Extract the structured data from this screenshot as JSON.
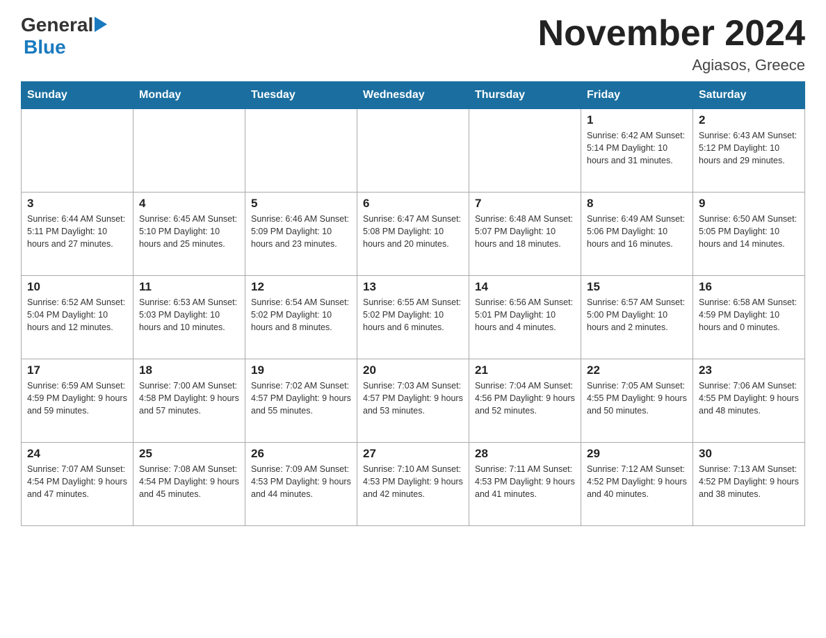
{
  "header": {
    "logo_general": "General",
    "logo_blue": "Blue",
    "month_title": "November 2024",
    "location": "Agiasos, Greece"
  },
  "days_of_week": [
    "Sunday",
    "Monday",
    "Tuesday",
    "Wednesday",
    "Thursday",
    "Friday",
    "Saturday"
  ],
  "weeks": [
    {
      "days": [
        {
          "number": "",
          "info": ""
        },
        {
          "number": "",
          "info": ""
        },
        {
          "number": "",
          "info": ""
        },
        {
          "number": "",
          "info": ""
        },
        {
          "number": "",
          "info": ""
        },
        {
          "number": "1",
          "info": "Sunrise: 6:42 AM\nSunset: 5:14 PM\nDaylight: 10 hours and 31 minutes."
        },
        {
          "number": "2",
          "info": "Sunrise: 6:43 AM\nSunset: 5:12 PM\nDaylight: 10 hours and 29 minutes."
        }
      ]
    },
    {
      "days": [
        {
          "number": "3",
          "info": "Sunrise: 6:44 AM\nSunset: 5:11 PM\nDaylight: 10 hours and 27 minutes."
        },
        {
          "number": "4",
          "info": "Sunrise: 6:45 AM\nSunset: 5:10 PM\nDaylight: 10 hours and 25 minutes."
        },
        {
          "number": "5",
          "info": "Sunrise: 6:46 AM\nSunset: 5:09 PM\nDaylight: 10 hours and 23 minutes."
        },
        {
          "number": "6",
          "info": "Sunrise: 6:47 AM\nSunset: 5:08 PM\nDaylight: 10 hours and 20 minutes."
        },
        {
          "number": "7",
          "info": "Sunrise: 6:48 AM\nSunset: 5:07 PM\nDaylight: 10 hours and 18 minutes."
        },
        {
          "number": "8",
          "info": "Sunrise: 6:49 AM\nSunset: 5:06 PM\nDaylight: 10 hours and 16 minutes."
        },
        {
          "number": "9",
          "info": "Sunrise: 6:50 AM\nSunset: 5:05 PM\nDaylight: 10 hours and 14 minutes."
        }
      ]
    },
    {
      "days": [
        {
          "number": "10",
          "info": "Sunrise: 6:52 AM\nSunset: 5:04 PM\nDaylight: 10 hours and 12 minutes."
        },
        {
          "number": "11",
          "info": "Sunrise: 6:53 AM\nSunset: 5:03 PM\nDaylight: 10 hours and 10 minutes."
        },
        {
          "number": "12",
          "info": "Sunrise: 6:54 AM\nSunset: 5:02 PM\nDaylight: 10 hours and 8 minutes."
        },
        {
          "number": "13",
          "info": "Sunrise: 6:55 AM\nSunset: 5:02 PM\nDaylight: 10 hours and 6 minutes."
        },
        {
          "number": "14",
          "info": "Sunrise: 6:56 AM\nSunset: 5:01 PM\nDaylight: 10 hours and 4 minutes."
        },
        {
          "number": "15",
          "info": "Sunrise: 6:57 AM\nSunset: 5:00 PM\nDaylight: 10 hours and 2 minutes."
        },
        {
          "number": "16",
          "info": "Sunrise: 6:58 AM\nSunset: 4:59 PM\nDaylight: 10 hours and 0 minutes."
        }
      ]
    },
    {
      "days": [
        {
          "number": "17",
          "info": "Sunrise: 6:59 AM\nSunset: 4:59 PM\nDaylight: 9 hours and 59 minutes."
        },
        {
          "number": "18",
          "info": "Sunrise: 7:00 AM\nSunset: 4:58 PM\nDaylight: 9 hours and 57 minutes."
        },
        {
          "number": "19",
          "info": "Sunrise: 7:02 AM\nSunset: 4:57 PM\nDaylight: 9 hours and 55 minutes."
        },
        {
          "number": "20",
          "info": "Sunrise: 7:03 AM\nSunset: 4:57 PM\nDaylight: 9 hours and 53 minutes."
        },
        {
          "number": "21",
          "info": "Sunrise: 7:04 AM\nSunset: 4:56 PM\nDaylight: 9 hours and 52 minutes."
        },
        {
          "number": "22",
          "info": "Sunrise: 7:05 AM\nSunset: 4:55 PM\nDaylight: 9 hours and 50 minutes."
        },
        {
          "number": "23",
          "info": "Sunrise: 7:06 AM\nSunset: 4:55 PM\nDaylight: 9 hours and 48 minutes."
        }
      ]
    },
    {
      "days": [
        {
          "number": "24",
          "info": "Sunrise: 7:07 AM\nSunset: 4:54 PM\nDaylight: 9 hours and 47 minutes."
        },
        {
          "number": "25",
          "info": "Sunrise: 7:08 AM\nSunset: 4:54 PM\nDaylight: 9 hours and 45 minutes."
        },
        {
          "number": "26",
          "info": "Sunrise: 7:09 AM\nSunset: 4:53 PM\nDaylight: 9 hours and 44 minutes."
        },
        {
          "number": "27",
          "info": "Sunrise: 7:10 AM\nSunset: 4:53 PM\nDaylight: 9 hours and 42 minutes."
        },
        {
          "number": "28",
          "info": "Sunrise: 7:11 AM\nSunset: 4:53 PM\nDaylight: 9 hours and 41 minutes."
        },
        {
          "number": "29",
          "info": "Sunrise: 7:12 AM\nSunset: 4:52 PM\nDaylight: 9 hours and 40 minutes."
        },
        {
          "number": "30",
          "info": "Sunrise: 7:13 AM\nSunset: 4:52 PM\nDaylight: 9 hours and 38 minutes."
        }
      ]
    }
  ]
}
